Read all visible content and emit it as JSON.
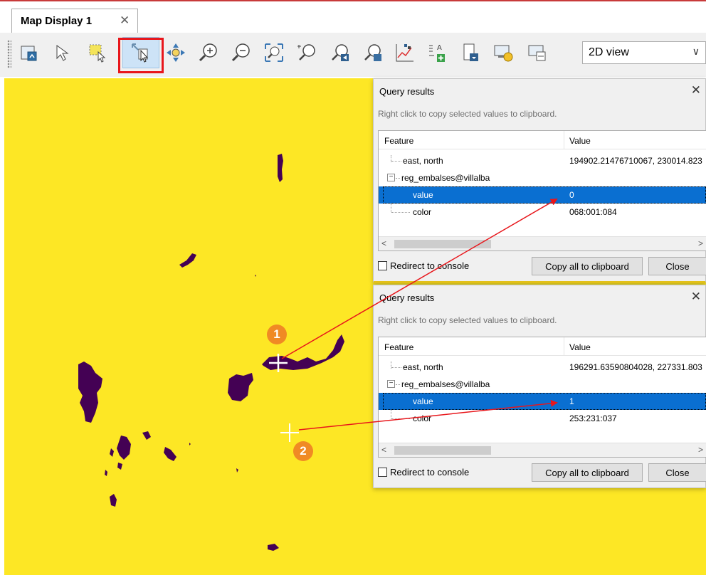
{
  "tab": {
    "label": "Map Display 1",
    "close_glyph": "✕"
  },
  "toolbar": {
    "tools": [
      {
        "name": "display-map-icon"
      },
      {
        "name": "pointer-icon"
      },
      {
        "name": "select-vector-icon"
      },
      {
        "name": "query-icon",
        "active": true
      },
      {
        "name": "pan-icon"
      },
      {
        "name": "zoom-in-icon"
      },
      {
        "name": "zoom-out-icon"
      },
      {
        "name": "zoom-extent-icon"
      },
      {
        "name": "zoom-region-icon"
      },
      {
        "name": "zoom-back-icon"
      },
      {
        "name": "zoom-menu-icon"
      },
      {
        "name": "analyze-icon"
      },
      {
        "name": "add-overlay-icon"
      },
      {
        "name": "save-image-icon"
      },
      {
        "name": "settings-icon"
      },
      {
        "name": "dock-icon"
      }
    ],
    "view_select": {
      "selected": "2D view",
      "arrow": "∨"
    }
  },
  "markers": [
    "1",
    "2"
  ],
  "colors": {
    "map_background": "#fde725",
    "water_features": "#440154",
    "annotation_red": "#e8161b",
    "marker_orange": "#f08a24",
    "selection_blue": "#0a6fd1"
  },
  "dialogs": [
    {
      "title": "Query results",
      "hint": "Right click to copy selected values to clipboard.",
      "col_feature": "Feature",
      "col_value": "Value",
      "rows": [
        {
          "feature": "east, north",
          "value": "194902.21476710067, 230014.823"
        },
        {
          "feature": "reg_embalses@villalba",
          "value": ""
        },
        {
          "feature": "value",
          "value": "0"
        },
        {
          "feature": "color",
          "value": "068:001:084"
        }
      ],
      "redirect_label": "Redirect to console",
      "copy_label": "Copy all to clipboard",
      "close_label": "Close"
    },
    {
      "title": "Query results",
      "hint": "Right click to copy selected values to clipboard.",
      "col_feature": "Feature",
      "col_value": "Value",
      "rows": [
        {
          "feature": "east, north",
          "value": "196291.63590804028, 227331.803"
        },
        {
          "feature": "reg_embalses@villalba",
          "value": ""
        },
        {
          "feature": "value",
          "value": "1"
        },
        {
          "feature": "color",
          "value": "253:231:037"
        }
      ],
      "redirect_label": "Redirect to console",
      "copy_label": "Copy all to clipboard",
      "close_label": "Close"
    }
  ]
}
